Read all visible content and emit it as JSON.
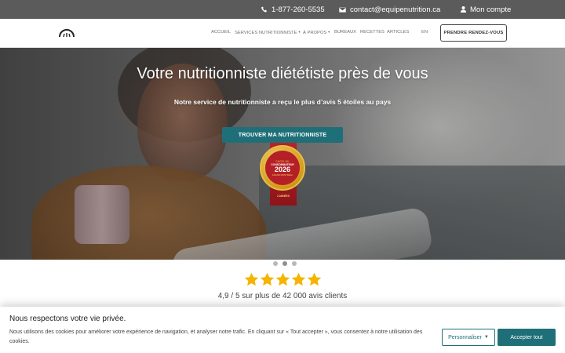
{
  "topbar": {
    "phone": "1-877-260-5535",
    "email": "contact@equipenutrition.ca",
    "account": "Mon compte",
    "icons": [
      "phone-icon",
      "envelope-icon",
      "user-icon"
    ]
  },
  "nav": {
    "items": [
      {
        "label": "ACCUEIL",
        "dropdown": false
      },
      {
        "label": "SERVICES NUTRITIONNISTE",
        "dropdown": true
      },
      {
        "label": "À PROPOS",
        "dropdown": true
      },
      {
        "label": "BUREAUX",
        "dropdown": false
      },
      {
        "label": "RECETTES",
        "dropdown": false
      },
      {
        "label": "ARTICLES",
        "dropdown": false
      }
    ],
    "language": "EN",
    "cta": "PRENDRE RENDEZ-VOUS"
  },
  "hero": {
    "title": "Votre nutritionniste diététiste près de vous",
    "subtitle": "Notre service de nutritionniste a reçu le plus d’avis 5 étoiles au pays",
    "button": "TROUVER MA NUTRITIONNISTE",
    "badge": {
      "line1": "CHOIX DU",
      "line2": "CONSOMMATEUR",
      "year": "2026",
      "region": "GRAND MONTRÉAL",
      "tag": "2 ANNÉES"
    },
    "slides": 3,
    "active_slide": 2
  },
  "rating": {
    "stars": 5,
    "star_color": "#f5b400",
    "text": "4,9 / 5 sur plus de 42 000 avis clients"
  },
  "cookie": {
    "title": "Nous respectons votre vie privée.",
    "text": "Nous utilisons des cookies pour améliorer votre expérience de navigation, et analyser notre trafic. En cliquant sur « Tout accepter », vous consentez à notre utilisation des cookies.",
    "customize": "Personnaliser",
    "accept": "Accepter tout"
  },
  "colors": {
    "accent": "#1f6f78",
    "topbar": "#5b5b5b"
  }
}
